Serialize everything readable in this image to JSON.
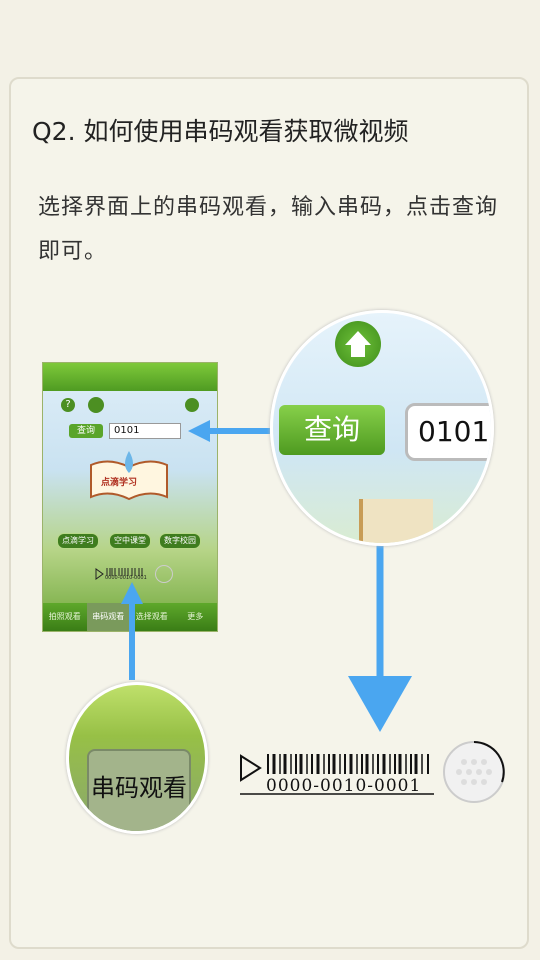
{
  "question": {
    "title": "Q2. 如何使用串码观看获取微视频"
  },
  "answer": {
    "text": "选择界面上的串码观看，输入串码，点击查询即可。"
  },
  "phone": {
    "help_icon": "?",
    "query_button": "查询",
    "input_value": "0101",
    "book_text": "点滴学习",
    "buttons": [
      "点滴学习",
      "空中课堂",
      "数字校园"
    ],
    "barcode_text": "0000-0010-0001",
    "tabs": [
      "拍照观看",
      "串码观看",
      "选择观看",
      "更多"
    ]
  },
  "magnifier_query": {
    "button": "查询",
    "input_value": "0101"
  },
  "magnifier_tab": {
    "label": "串码观看"
  },
  "barcode": {
    "code": "0000-0010-0001"
  },
  "colors": {
    "accent_green": "#5aa52a",
    "arrow_blue": "#4aa6f0"
  }
}
